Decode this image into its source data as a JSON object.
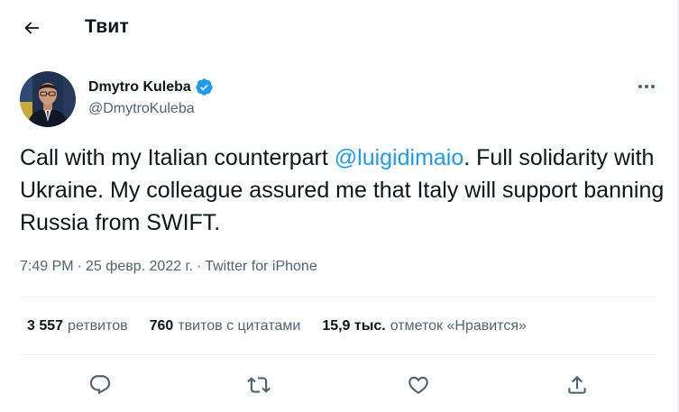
{
  "header": {
    "back_icon": "arrow-left-icon",
    "title": "Твит"
  },
  "author": {
    "name": "Dmytro Kuleba",
    "handle": "@DmytroKuleba",
    "verified_icon": "verified-badge-icon",
    "avatar_icon": "avatar-photo"
  },
  "menu": {
    "icon": "more-horizontal-icon"
  },
  "tweet": {
    "text_before": "Call with my Italian counterpart ",
    "mention": "@luigidimaio",
    "text_after": ". Full solidarity with Ukraine. My colleague assured me that Italy will support banning Russia from SWIFT."
  },
  "meta": {
    "time": "7:49 PM",
    "sep1": "·",
    "date": "25 февр. 2022 г.",
    "sep2": "·",
    "source": "Twitter for iPhone"
  },
  "stats": {
    "retweets_count": "3 557",
    "retweets_label": "ретвитов",
    "quotes_count": "760",
    "quotes_label": "твитов с цитатами",
    "likes_count": "15,9 тыс.",
    "likes_label": "отметок «Нравится»"
  },
  "actions": [
    {
      "icon": "reply-icon"
    },
    {
      "icon": "retweet-icon"
    },
    {
      "icon": "like-heart-icon"
    },
    {
      "icon": "share-icon"
    }
  ],
  "colors": {
    "accent": "#1d9bf0",
    "text": "#0f1419",
    "secondary": "#536471",
    "divider": "#eff3f4"
  }
}
